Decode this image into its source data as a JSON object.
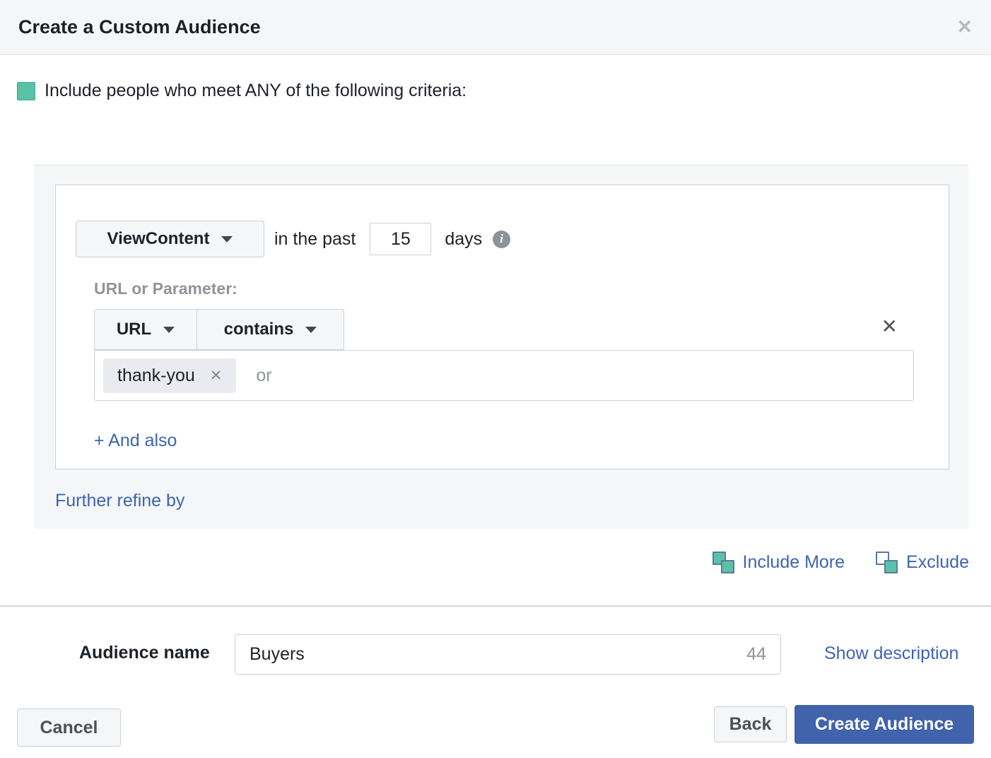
{
  "header": {
    "title": "Create a Custom Audience",
    "close_icon": "✕"
  },
  "include_section": {
    "label": "Include people who meet ANY of the following criteria:"
  },
  "rule": {
    "event": "ViewContent",
    "in_the_past_label": "in the past",
    "days_value": "15",
    "days_label": "days",
    "info_icon": "i",
    "url_param_label": "URL or Parameter:",
    "field": "URL",
    "operator": "contains",
    "tag": "thank-you",
    "tag_remove_icon": "✕",
    "or_placeholder": "or",
    "and_also_label": "+ And also",
    "remove_icon": "✕"
  },
  "refine_link": "Further refine by",
  "audience_actions": {
    "include_more": "Include More",
    "exclude": "Exclude"
  },
  "name_row": {
    "label": "Audience name",
    "value": "Buyers",
    "char_count": "44",
    "show_description": "Show description"
  },
  "footer": {
    "cancel": "Cancel",
    "back": "Back",
    "create": "Create Audience"
  },
  "colors": {
    "teal": "#59c3a9",
    "link_blue": "#3e64b4",
    "button_blue": "#4063ac",
    "panel_gray": "#f5f6f7",
    "border_gray": "#ccd0d5"
  }
}
